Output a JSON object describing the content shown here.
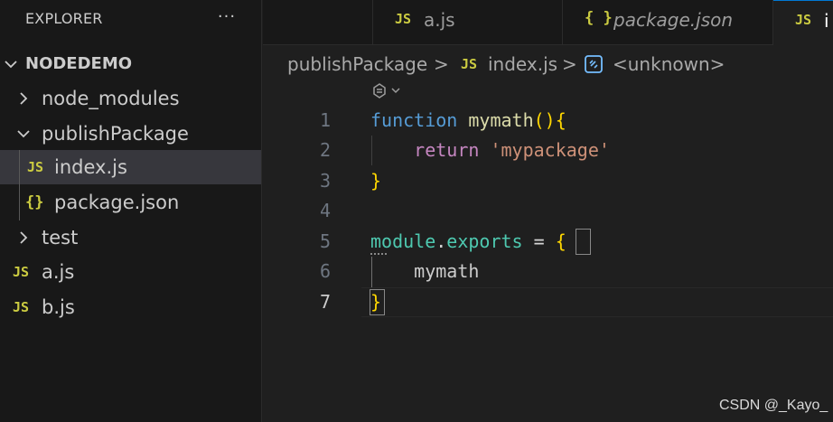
{
  "sidebar": {
    "title": "EXPLORER",
    "more_label": "···",
    "root": "NODEDEMO",
    "items": [
      {
        "label": "node_modules",
        "icon": "chevron-right"
      },
      {
        "label": "publishPackage",
        "icon": "chevron-down"
      },
      {
        "label": "index.js",
        "icon": "JS"
      },
      {
        "label": "package.json",
        "icon": "{}"
      },
      {
        "label": "test",
        "icon": "chevron-right"
      },
      {
        "label": "a.js",
        "icon": "JS"
      },
      {
        "label": "b.js",
        "icon": "JS"
      }
    ]
  },
  "tabs": [
    {
      "label": "a.js",
      "icon": "JS"
    },
    {
      "label": "package.json",
      "icon": "{ }"
    },
    {
      "label": "i",
      "icon": "JS"
    }
  ],
  "breadcrumb": {
    "folder": "publishPackage",
    "file": "index.js",
    "symbol": "<unknown>",
    "separator": ">"
  },
  "editor": {
    "line_numbers": [
      "1",
      "2",
      "3",
      "4",
      "5",
      "6",
      "7"
    ],
    "active_line": "7",
    "tokens": {
      "l1_kw": "function",
      "l1_fn": "mymath",
      "l1_paren": "()",
      "l1_brace": "{",
      "l2_ret": "return",
      "l2_str": "'mypackage'",
      "l3_brace": "}",
      "l5_var": "module",
      "l5_dot": ".",
      "l5_prop": "exports",
      "l5_eq": " = ",
      "l5_brace": "{",
      "l6_ident": "mymath",
      "l7_brace": "}"
    }
  },
  "watermark": "CSDN @_Kayo_",
  "colors": {
    "accent": "#0078d4",
    "js_icon": "#cbcb41",
    "keyword": "#569cd6",
    "function": "#dcdcaa",
    "string": "#ce9178",
    "return": "#c586c0"
  }
}
